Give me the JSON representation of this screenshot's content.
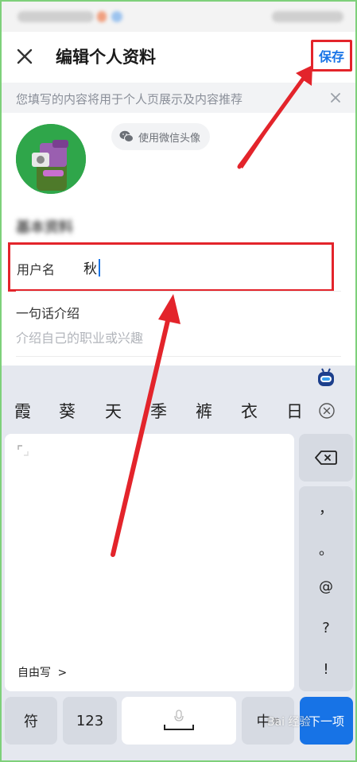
{
  "header": {
    "title": "编辑个人资料",
    "save_label": "保存"
  },
  "banner": {
    "text": "您填写的内容将用于个人页展示及内容推荐"
  },
  "avatar": {
    "wechat_button_label": "使用微信头像"
  },
  "profile": {
    "section_heading": "基本资料",
    "username_label": "用户名",
    "username_value": "秋",
    "intro_label": "一句话介绍",
    "intro_placeholder": "介绍自己的职业或兴趣"
  },
  "keyboard": {
    "candidates": [
      "霞",
      "葵",
      "天",
      "季",
      "裤",
      "衣",
      "日"
    ],
    "freewrite_label": "自由写",
    "punctuation": [
      "，",
      "。",
      "@",
      "?",
      "!"
    ],
    "keys": {
      "symbols": "符",
      "numbers": "123",
      "lang_main": "中",
      "lang_sub": "英",
      "next": "下一项"
    }
  },
  "watermark": {
    "text": "Bai 经验"
  },
  "colors": {
    "accent": "#1773e6",
    "annotation_red": "#e3242b",
    "keyboard_bg": "#e5e8ef"
  }
}
